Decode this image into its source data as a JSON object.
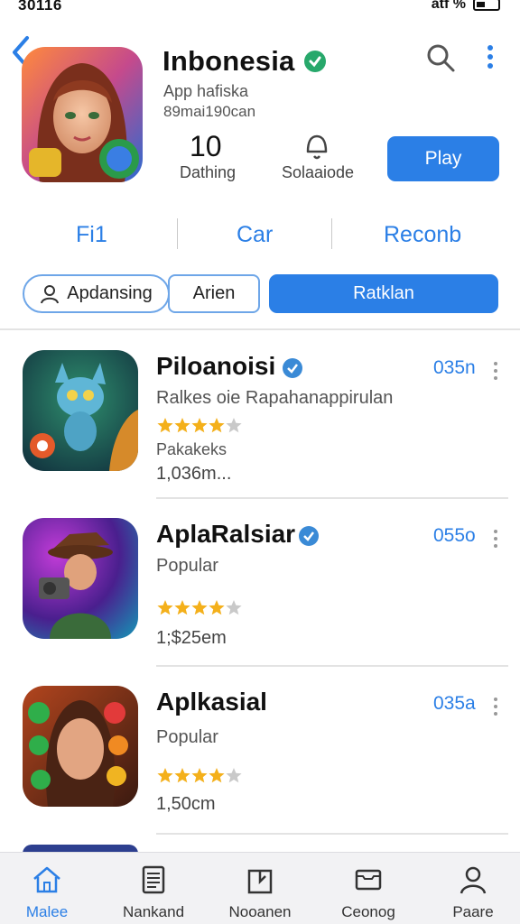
{
  "status_bar": {
    "time": "30116",
    "carrier": "atf %"
  },
  "header": {
    "app_name": "Inbonesia",
    "subtitle": "App hafiska",
    "meta": "89mai190can",
    "stat_value": "10",
    "stat_label": "Dathing",
    "stat2_label": "Solaaiode",
    "play_label": "Play"
  },
  "tabs": [
    {
      "label": "Fi1"
    },
    {
      "label": "Car"
    },
    {
      "label": "Reconb"
    }
  ],
  "filters": [
    {
      "label": "Apdansing"
    },
    {
      "label": "Arien"
    },
    {
      "label": "Ratklan"
    }
  ],
  "apps": [
    {
      "title": "Piloanoisi",
      "subtitle": "Ralkes oie  Rapahanappirulan",
      "extra": "Pakakeks",
      "count": "1,036m...",
      "size": "035n",
      "rating": 4
    },
    {
      "title": "AplaRalsiar",
      "subtitle": "Popular",
      "extra": "",
      "count": "1;$25em",
      "size": "055o",
      "rating": 4
    },
    {
      "title": "Aplkasial",
      "subtitle": "Popular",
      "extra": "",
      "count": "1,50cm",
      "size": "035a",
      "rating": 4
    }
  ],
  "bottom_nav": [
    {
      "label": "Malee",
      "icon": "home-icon"
    },
    {
      "label": "Nankand",
      "icon": "document-icon"
    },
    {
      "label": "Nooanen",
      "icon": "clipboard-icon"
    },
    {
      "label": "Ceonog",
      "icon": "inbox-icon"
    },
    {
      "label": "Paare",
      "icon": "person-icon"
    }
  ],
  "colors": {
    "accent": "#2b7fe6",
    "verified": "#27a86b",
    "star": "#f4b01b"
  }
}
